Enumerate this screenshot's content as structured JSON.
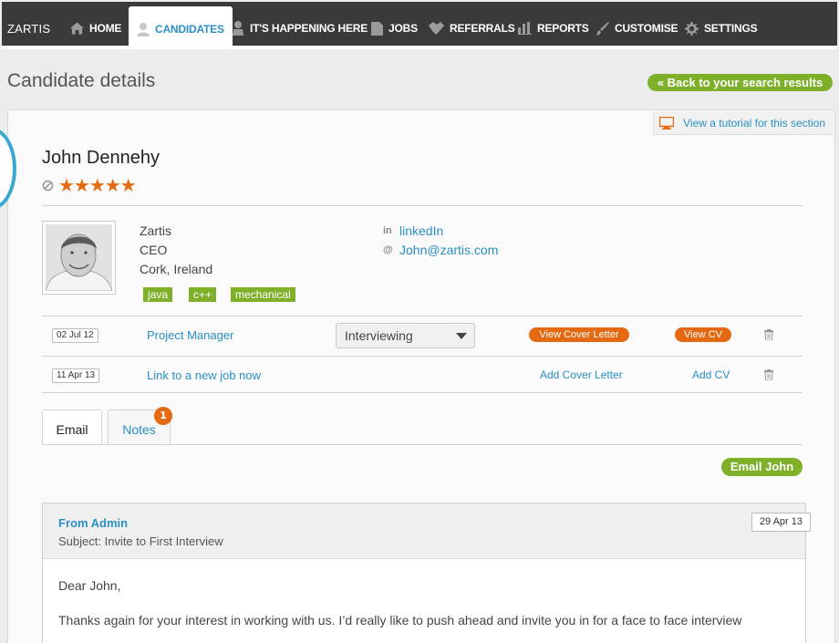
{
  "nav": {
    "brand": "ZARTIS",
    "items": [
      {
        "label": "HOME",
        "icon": "home-icon"
      },
      {
        "label": "CANDIDATES",
        "icon": "user-icon"
      },
      {
        "label": "IT'S HAPPENING HERE",
        "icon": "person-icon"
      },
      {
        "label": "JOBS",
        "icon": "document-icon"
      },
      {
        "label": "REFERRALS",
        "icon": "handshake-icon"
      },
      {
        "label": "REPORTS",
        "icon": "bar-chart-icon"
      },
      {
        "label": "CUSTOMISE",
        "icon": "brush-icon"
      },
      {
        "label": "SETTINGS",
        "icon": "gear-icon"
      }
    ],
    "active_item": "CANDIDATES"
  },
  "page": {
    "title": "Candidate details",
    "back_label": "« Back to your search results",
    "tutorial_label": "View a tutorial for this section"
  },
  "candidate": {
    "name": "John Dennehy",
    "rating": "★★★★★",
    "company": "Zartis",
    "role": "CEO",
    "location": "Cork, Ireland",
    "tags": [
      "java",
      "c++",
      "mechanical"
    ],
    "linkedin_label": "linkedIn",
    "linkedin_icon_text": "in",
    "email_icon_text": "@",
    "email": "John@zartis.com"
  },
  "applications": [
    {
      "date": "02 Jul 12",
      "job": "Project Manager",
      "status": "Interviewing",
      "cover_letter": "View Cover Letter",
      "cv": "View CV"
    },
    {
      "date": "11 Apr 13",
      "job": "Link to a new job now",
      "cover_letter": "Add Cover Letter",
      "cv": "Add CV"
    }
  ],
  "tabs": {
    "email": "Email",
    "notes": "Notes",
    "notes_count": "1"
  },
  "email_button": "Email John",
  "message": {
    "from": "From Admin",
    "subject": "Subject: Invite to First Interview",
    "date": "29 Apr 13",
    "greeting": "Dear John,",
    "body": "Thanks again for your interest in working with us. I’d really like to push ahead and invite you in for a face to face interview"
  },
  "colors": {
    "nav_bg": "#3a3a3a",
    "accent_blue": "#2a8fc4",
    "green": "#7fb02a",
    "orange": "#e36a12"
  }
}
